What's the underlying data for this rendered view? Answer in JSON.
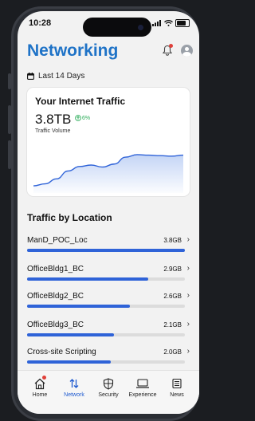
{
  "status": {
    "time": "10:28"
  },
  "header": {
    "title": "Networking"
  },
  "period": {
    "label": "Last 14 Days"
  },
  "traffic_card": {
    "title": "Your Internet Traffic",
    "value": "3.8TB",
    "change": "6%",
    "subtitle": "Traffic Volume",
    "trend": [
      0.08,
      0.12,
      0.22,
      0.38,
      0.47,
      0.5,
      0.46,
      0.52,
      0.66,
      0.71,
      0.7,
      0.69,
      0.68,
      0.7
    ]
  },
  "locations_section": {
    "title": "Traffic by Location"
  },
  "locations": [
    {
      "name": "ManD_POC_Loc",
      "value": "3.8GB",
      "fraction": 1.0
    },
    {
      "name": "OfficeBldg1_BC",
      "value": "2.9GB",
      "fraction": 0.77
    },
    {
      "name": "OfficeBldg2_BC",
      "value": "2.6GB",
      "fraction": 0.65
    },
    {
      "name": "OfficeBldg3_BC",
      "value": "2.1GB",
      "fraction": 0.55
    },
    {
      "name": "Cross-site Scripting",
      "value": "2.0GB",
      "fraction": 0.53
    }
  ],
  "tabs": [
    {
      "label": "Home",
      "icon": "home-icon"
    },
    {
      "label": "Network",
      "icon": "network-arrows-icon"
    },
    {
      "label": "Security",
      "icon": "shield-icon"
    },
    {
      "label": "Experience",
      "icon": "laptop-icon"
    },
    {
      "label": "News",
      "icon": "newspaper-icon"
    }
  ],
  "colors": {
    "accent": "#1f73c7",
    "bar": "#2f63d8",
    "positive": "#2fae5c",
    "alert": "#e0403a"
  }
}
